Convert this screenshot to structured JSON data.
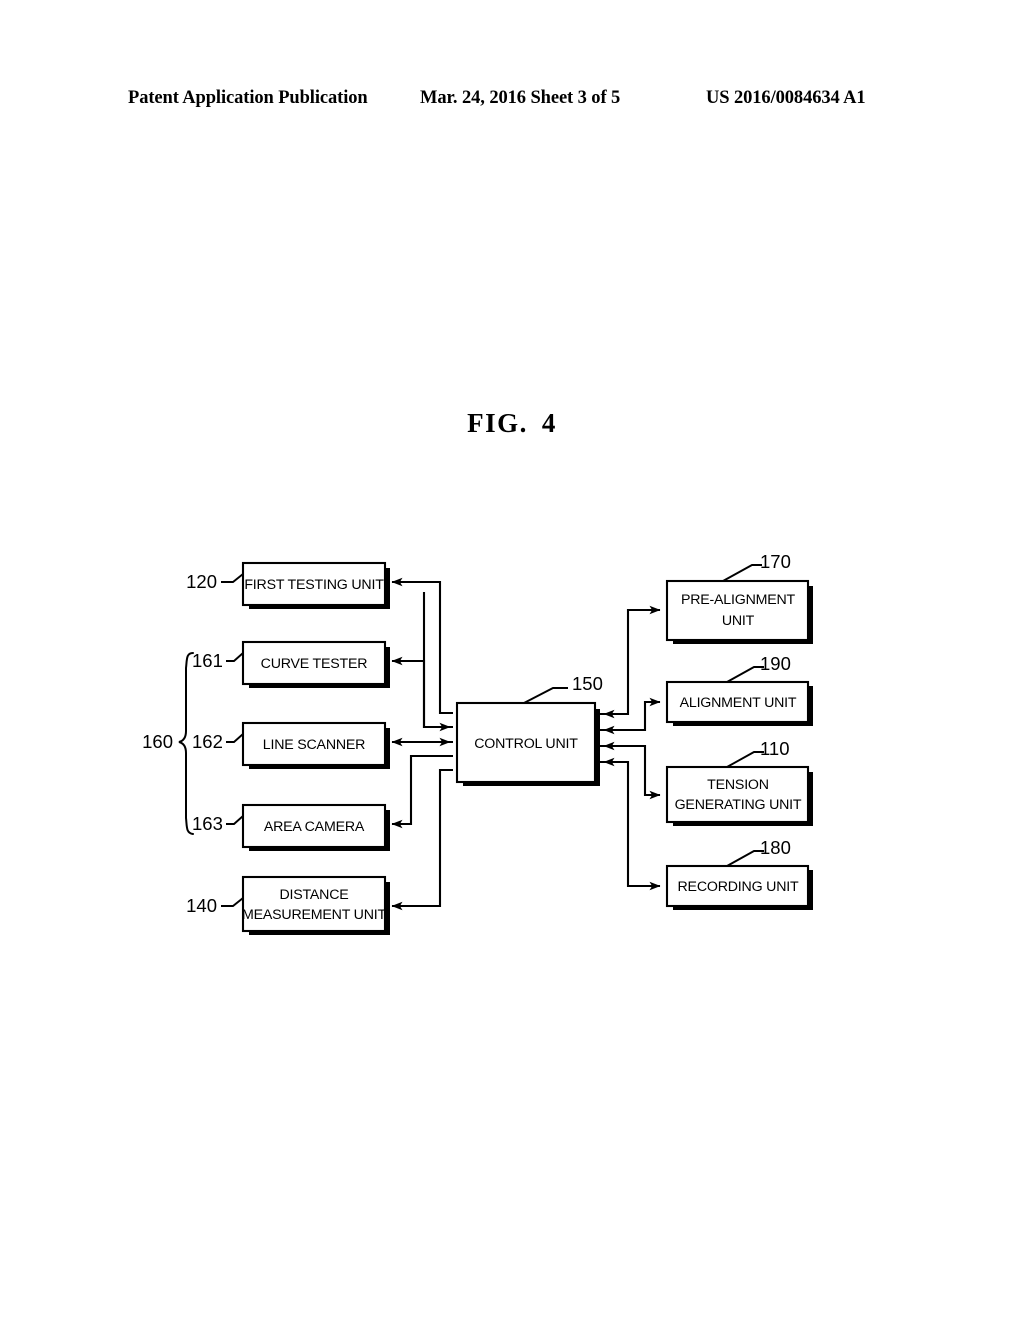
{
  "header": {
    "left": "Patent Application Publication",
    "middle": "Mar. 24, 2016  Sheet 3 of 5",
    "right": "US 2016/0084634 A1"
  },
  "figure": {
    "label": "FIG.",
    "number": "4"
  },
  "chart_data": {
    "type": "diagram",
    "title": "FIG. 4",
    "description": "Block diagram of a testing apparatus: a central control unit exchanges signals with five input/sensor blocks on the left and four actuator/output blocks on the right.",
    "nodes": [
      {
        "id": "first_testing_unit",
        "ref": "120",
        "label": "FIRST TESTING UNIT",
        "side": "left"
      },
      {
        "id": "curve_tester",
        "ref": "161",
        "label": "CURVE TESTER",
        "side": "left"
      },
      {
        "id": "line_scanner",
        "ref": "162",
        "label": "LINE SCANNER",
        "side": "left"
      },
      {
        "id": "area_camera",
        "ref": "163",
        "label": "AREA CAMERA",
        "side": "left"
      },
      {
        "id": "distance_measurement",
        "ref": "140",
        "label": "DISTANCE MEASUREMENT UNIT",
        "side": "left"
      },
      {
        "id": "control_unit",
        "ref": "150",
        "label": "CONTROL UNIT",
        "side": "center"
      },
      {
        "id": "pre_alignment_unit",
        "ref": "170",
        "label": "PRE-ALIGNMENT UNIT",
        "side": "right"
      },
      {
        "id": "alignment_unit",
        "ref": "190",
        "label": "ALIGNMENT UNIT",
        "side": "right"
      },
      {
        "id": "tension_generating",
        "ref": "110",
        "label": "TENSION GENERATING UNIT",
        "side": "right"
      },
      {
        "id": "recording_unit",
        "ref": "180",
        "label": "RECORDING UNIT",
        "side": "right"
      }
    ],
    "groups": [
      {
        "id": "testing_group",
        "ref": "160",
        "members": [
          "161",
          "162",
          "163"
        ],
        "bracket": "brace"
      }
    ],
    "edges": [
      {
        "from": "control_unit",
        "to": "first_testing_unit",
        "direction": "to-left"
      },
      {
        "from": "control_unit",
        "to": "curve_tester",
        "direction": "to-left"
      },
      {
        "from": "control_unit",
        "to": "line_scanner",
        "direction": "to-left"
      },
      {
        "from": "control_unit",
        "to": "area_camera",
        "direction": "to-left"
      },
      {
        "from": "control_unit",
        "to": "distance_measurement",
        "direction": "to-left"
      },
      {
        "from": "first_testing_unit",
        "to": "control_unit",
        "direction": "to-right"
      },
      {
        "from": "curve_tester",
        "to": "control_unit",
        "direction": "to-right"
      },
      {
        "from": "line_scanner",
        "to": "control_unit",
        "direction": "to-right"
      },
      {
        "from": "area_camera",
        "to": "control_unit",
        "direction": "to-right"
      },
      {
        "from": "distance_measurement",
        "to": "control_unit",
        "direction": "to-right"
      },
      {
        "from": "control_unit",
        "to": "pre_alignment_unit",
        "direction": "to-right"
      },
      {
        "from": "control_unit",
        "to": "alignment_unit",
        "direction": "to-right"
      },
      {
        "from": "control_unit",
        "to": "tension_generating",
        "direction": "to-right"
      },
      {
        "from": "control_unit",
        "to": "recording_unit",
        "direction": "to-right"
      },
      {
        "from": "pre_alignment_unit",
        "to": "control_unit",
        "direction": "to-left"
      },
      {
        "from": "alignment_unit",
        "to": "control_unit",
        "direction": "to-left"
      },
      {
        "from": "tension_generating",
        "to": "control_unit",
        "direction": "to-left"
      },
      {
        "from": "recording_unit",
        "to": "control_unit",
        "direction": "to-left"
      }
    ]
  },
  "boxes": {
    "first_testing_unit": {
      "ref": "120",
      "line1": "FIRST TESTING UNIT"
    },
    "curve_tester": {
      "ref": "161",
      "line1": "CURVE TESTER"
    },
    "line_scanner": {
      "ref": "162",
      "line1": "LINE SCANNER"
    },
    "area_camera": {
      "ref": "163",
      "line1": "AREA CAMERA"
    },
    "distance_measurement": {
      "ref": "140",
      "line1": "DISTANCE",
      "line2": "MEASUREMENT UNIT"
    },
    "control_unit": {
      "ref": "150",
      "line1": "CONTROL UNIT"
    },
    "pre_alignment_unit": {
      "ref": "170",
      "line1": "PRE-ALIGNMENT",
      "line2": "UNIT"
    },
    "alignment_unit": {
      "ref": "190",
      "line1": "ALIGNMENT UNIT"
    },
    "tension_generating": {
      "ref": "110",
      "line1": "TENSION",
      "line2": "GENERATING UNIT"
    },
    "recording_unit": {
      "ref": "180",
      "line1": "RECORDING UNIT"
    },
    "group_160": {
      "ref": "160"
    }
  },
  "colors": {
    "ink": "#000000",
    "paper": "#ffffff"
  }
}
